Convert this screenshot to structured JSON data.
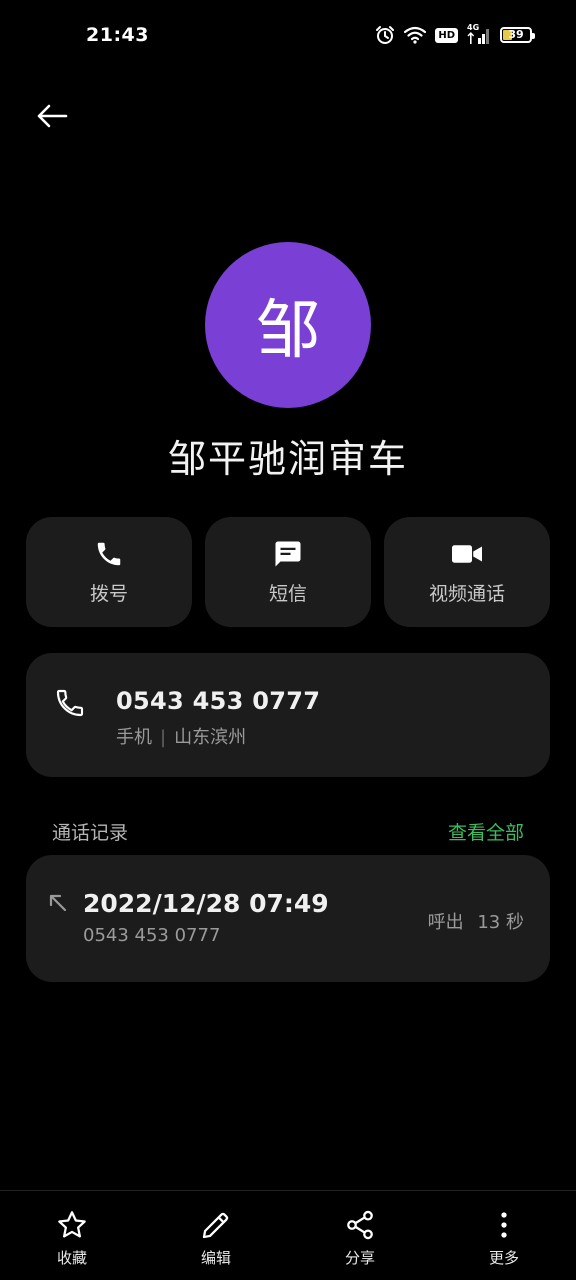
{
  "status_bar": {
    "time": "21:43",
    "hd": "HD",
    "network": "4G",
    "battery": "39",
    "battery_level_percent": 39,
    "battery_color": "#e8c84a"
  },
  "contact": {
    "avatar_char": "邹",
    "avatar_color": "#7a3fd4",
    "name": "邹平驰润审车"
  },
  "actions": [
    {
      "label": "拨号",
      "icon": "phone-icon"
    },
    {
      "label": "短信",
      "icon": "message-icon"
    },
    {
      "label": "视频通话",
      "icon": "video-call-icon"
    }
  ],
  "phone": {
    "number": "0543 453 0777",
    "type": "手机",
    "separator": "|",
    "location": "山东滨州"
  },
  "call_log": {
    "title": "通话记录",
    "view_all": "查看全部",
    "view_all_color": "#3dbb5e",
    "entries": [
      {
        "datetime": "2022/12/28 07:49",
        "number": "0543 453 0777",
        "direction": "呼出",
        "duration": "13 秒",
        "icon": "outgoing-call-icon"
      }
    ]
  },
  "bottom_bar": [
    {
      "label": "收藏",
      "icon": "star-icon"
    },
    {
      "label": "编辑",
      "icon": "pencil-icon"
    },
    {
      "label": "分享",
      "icon": "share-icon"
    },
    {
      "label": "更多",
      "icon": "more-vertical-icon"
    }
  ]
}
